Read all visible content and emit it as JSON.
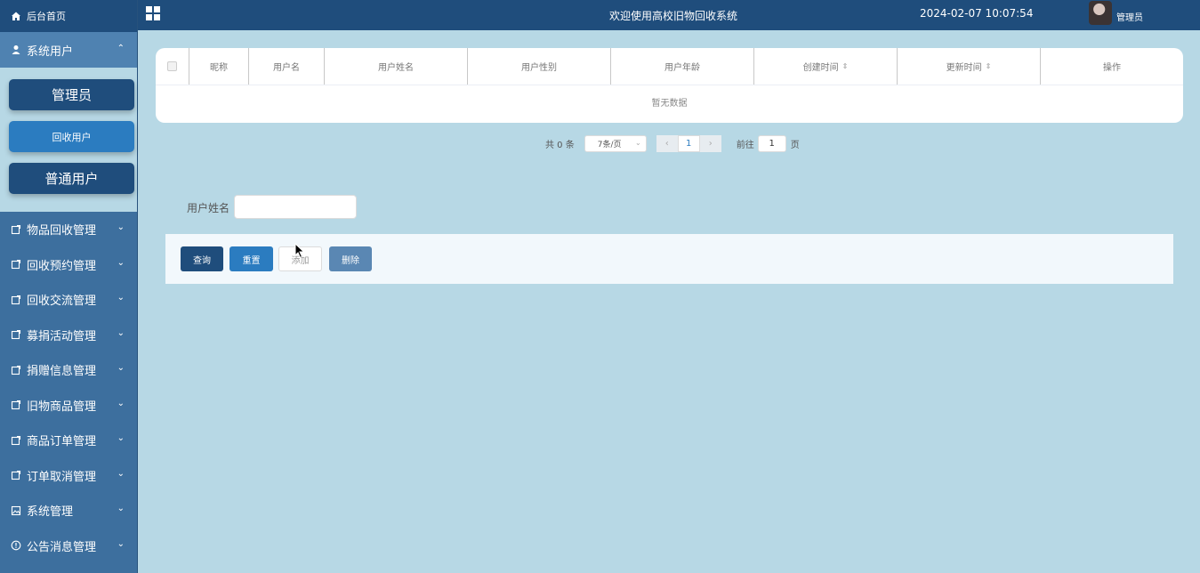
{
  "sidebar": {
    "home": "后台首页",
    "group": {
      "label": "系统用户",
      "caret": "⌃"
    },
    "sub_items": [
      "管理员",
      "回收用户",
      "普通用户"
    ],
    "items": [
      {
        "label": "物品回收管理",
        "icon": "box-icon"
      },
      {
        "label": "回收预约管理",
        "icon": "box-icon"
      },
      {
        "label": "回收交流管理",
        "icon": "box-icon"
      },
      {
        "label": "募捐活动管理",
        "icon": "box-icon"
      },
      {
        "label": "捐赠信息管理",
        "icon": "box-icon"
      },
      {
        "label": "旧物商品管理",
        "icon": "box-icon"
      },
      {
        "label": "商品订单管理",
        "icon": "box-icon"
      },
      {
        "label": "订单取消管理",
        "icon": "box-icon"
      },
      {
        "label": "系统管理",
        "icon": "image-icon"
      },
      {
        "label": "公告消息管理",
        "icon": "info-icon"
      }
    ]
  },
  "header": {
    "title": "欢迎使用高校旧物回收系统",
    "datetime": "2024-02-07 10:07:54",
    "user": "管理员"
  },
  "table": {
    "columns": [
      "昵称",
      "用户名",
      "用户姓名",
      "用户性别",
      "用户年龄",
      "创建时间",
      "更新时间",
      "操作"
    ],
    "empty_text": "暂无数据"
  },
  "pagination": {
    "total": "共 0 条",
    "page_size": "7条/页",
    "current_page": "1",
    "goto_label": "前往",
    "goto_value": "1",
    "goto_suffix": "页"
  },
  "search": {
    "label": "用户姓名",
    "value": "",
    "placeholder": ""
  },
  "buttons": {
    "query": "查询",
    "reset": "重置",
    "add": "添加",
    "delete": "删除"
  },
  "colors": {
    "header": "#1f4d7c",
    "sidebar": "#3d6f9e",
    "background": "#b7d8e5",
    "accent": "#2b7cc0"
  }
}
